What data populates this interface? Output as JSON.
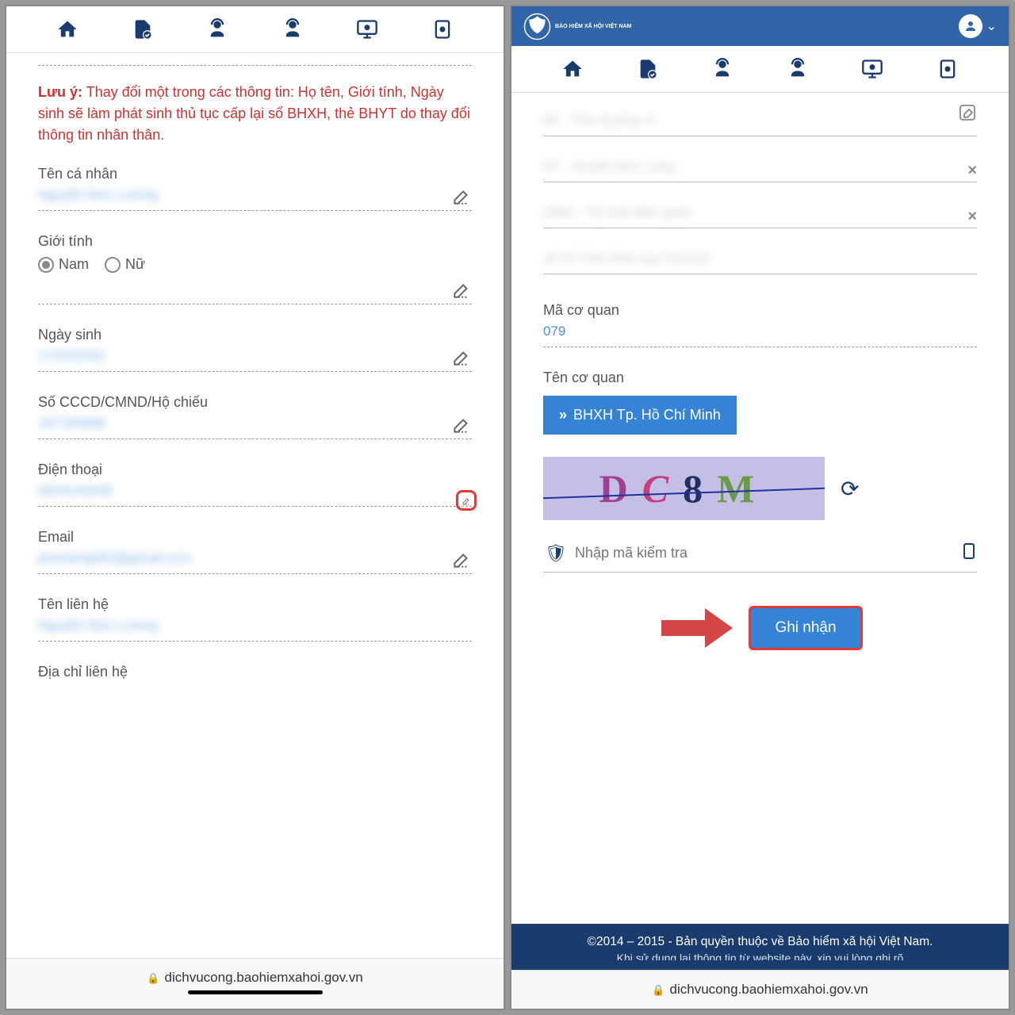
{
  "warning_label": "Lưu ý:",
  "warning_text": "Thay đổi một trong các thông tin: Họ tên, Giới tính, Ngày sinh sẽ làm phát sinh thủ tục cấp lại sổ BHXH, thẻ BHYT do thay đổi thông tin nhân thân.",
  "left": {
    "name_label": "Tên cá nhân",
    "name_value": "Nguyễn Đức Lương",
    "gender_label": "Giới tính",
    "gender_male": "Nam",
    "gender_female": "Nữ",
    "dob_label": "Ngày sinh",
    "dob_value": "17/03/2002",
    "id_label": "Số CCCD/CMND/Hộ chiếu",
    "id_value": "197180888",
    "phone_label": "Điện thoại",
    "phone_value": "0824143246",
    "email_label": "Email",
    "email_value": "phanlang063@gmail.com",
    "contact_name_label": "Tên liên hệ",
    "contact_name_value": "Nguyễn Đức Lương",
    "address_label": "Địa chỉ liên hệ"
  },
  "right": {
    "code_label": "Mã cơ quan",
    "code_value": "079",
    "org_label": "Tên cơ quan",
    "org_button": "BHXH Tp. Hồ Chí Minh",
    "captcha": "DC8M",
    "captcha_placeholder": "Nhập mã kiểm tra",
    "submit": "Ghi nhận",
    "footer1": "©2014 – 2015 - Bản quyền thuộc về Bảo hiểm xã hội Việt Nam.",
    "footer2": "Khi sử dụng lại thông tin từ website này, xin vui lòng ghi rõ"
  },
  "url": "dichvucong.baohiemxahoi.gov.vn",
  "logo_text": "BẢO HIỂM XÃ HỘI VIỆT NAM"
}
